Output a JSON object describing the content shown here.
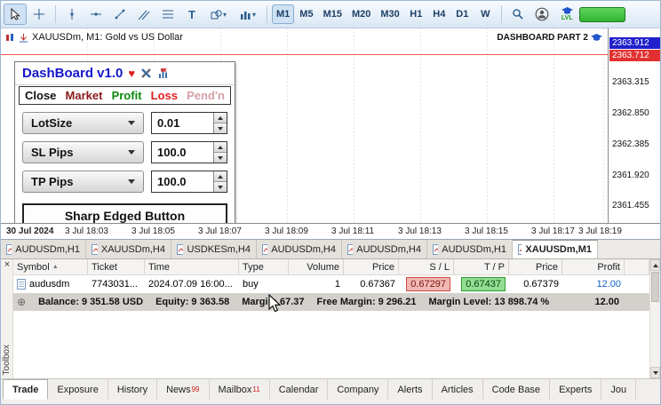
{
  "icons": {
    "close": "×",
    "sort_asc": "▲",
    "caret": "▾",
    "heart": "♥",
    "expand": "⊕",
    "text_tool": "T"
  },
  "colors": {
    "bid_badge": "#2020cc",
    "ask_badge": "#e23030",
    "profit_text": "#1565c8",
    "sl_bg": "#f2b9b4",
    "tp_bg": "#93dc93",
    "accent_blue": "#1515cc"
  },
  "toolbar": {
    "timeframes": [
      "M1",
      "M5",
      "M15",
      "M20",
      "M30",
      "H1",
      "H4",
      "D1",
      "W"
    ],
    "active_timeframe": "M1",
    "lvl_label": "LVL"
  },
  "chart": {
    "title": "XAUUSDm, M1: Gold vs US Dollar",
    "overlay_label": "DASHBOARD PART 2",
    "price_badges": [
      {
        "value": "2363.912",
        "color": "blue"
      },
      {
        "value": "2363.712",
        "color": "red"
      }
    ],
    "price_values": [
      "2363.315",
      "2362.850",
      "2362.385",
      "2361.920",
      "2361.455"
    ],
    "time_axis": [
      "30 Jul 2024",
      "3 Jul 18:03",
      "3 Jul 18:05",
      "3 Jul 18:07",
      "3 Jul 18:09",
      "3 Jul 18:11",
      "3 Jul 18:13",
      "3 Jul 18:15",
      "3 Jul 18:17",
      "3 Jul 18:19"
    ]
  },
  "dashboard": {
    "title": "DashBoard v1.0",
    "menu": [
      "Close",
      "Market",
      "Profit",
      "Loss",
      "Pend'n"
    ],
    "rows": [
      {
        "label": "LotSize",
        "value": "0.01"
      },
      {
        "label": "SL Pips",
        "value": "100.0"
      },
      {
        "label": "TP Pips",
        "value": "100.0"
      }
    ],
    "big_button": "Sharp Edged Button"
  },
  "chart_tabs": [
    "AUDUSDm,H1",
    "XAUUSDm,H4",
    "USDKESm,H4",
    "AUDUSDm,H4",
    "AUDUSDm,H4",
    "AUDUSDm,H1",
    "XAUUSDm,M1"
  ],
  "toolbox": {
    "panel_label": "Toolbox",
    "columns": [
      "Symbol",
      "Ticket",
      "Time",
      "Type",
      "Volume",
      "Price",
      "S / L",
      "T / P",
      "Price",
      "Profit"
    ],
    "trade_row": {
      "symbol": "audusdm",
      "ticket": "7743031...",
      "time": "2024.07.09 16:00...",
      "type": "buy",
      "volume": "1",
      "price_open": "0.67367",
      "sl": "0.67297",
      "tp": "0.67437",
      "price_current": "0.67379",
      "profit": "12.00"
    },
    "summary": {
      "balance": "Balance: 9 351.58 USD",
      "equity": "Equity: 9 363.58",
      "margin": "Margin: 67.37",
      "free_margin": "Free Margin: 9 296.21",
      "margin_level": "Margin Level: 13 898.74 %",
      "profit": "12.00"
    }
  },
  "bottom_tabs": [
    {
      "label": "Trade"
    },
    {
      "label": "Exposure"
    },
    {
      "label": "History"
    },
    {
      "label": "News",
      "badge": "99"
    },
    {
      "label": "Mailbox",
      "badge": "11"
    },
    {
      "label": "Calendar"
    },
    {
      "label": "Company"
    },
    {
      "label": "Alerts"
    },
    {
      "label": "Articles"
    },
    {
      "label": "Code Base"
    },
    {
      "label": "Experts"
    },
    {
      "label": "Jou"
    }
  ]
}
